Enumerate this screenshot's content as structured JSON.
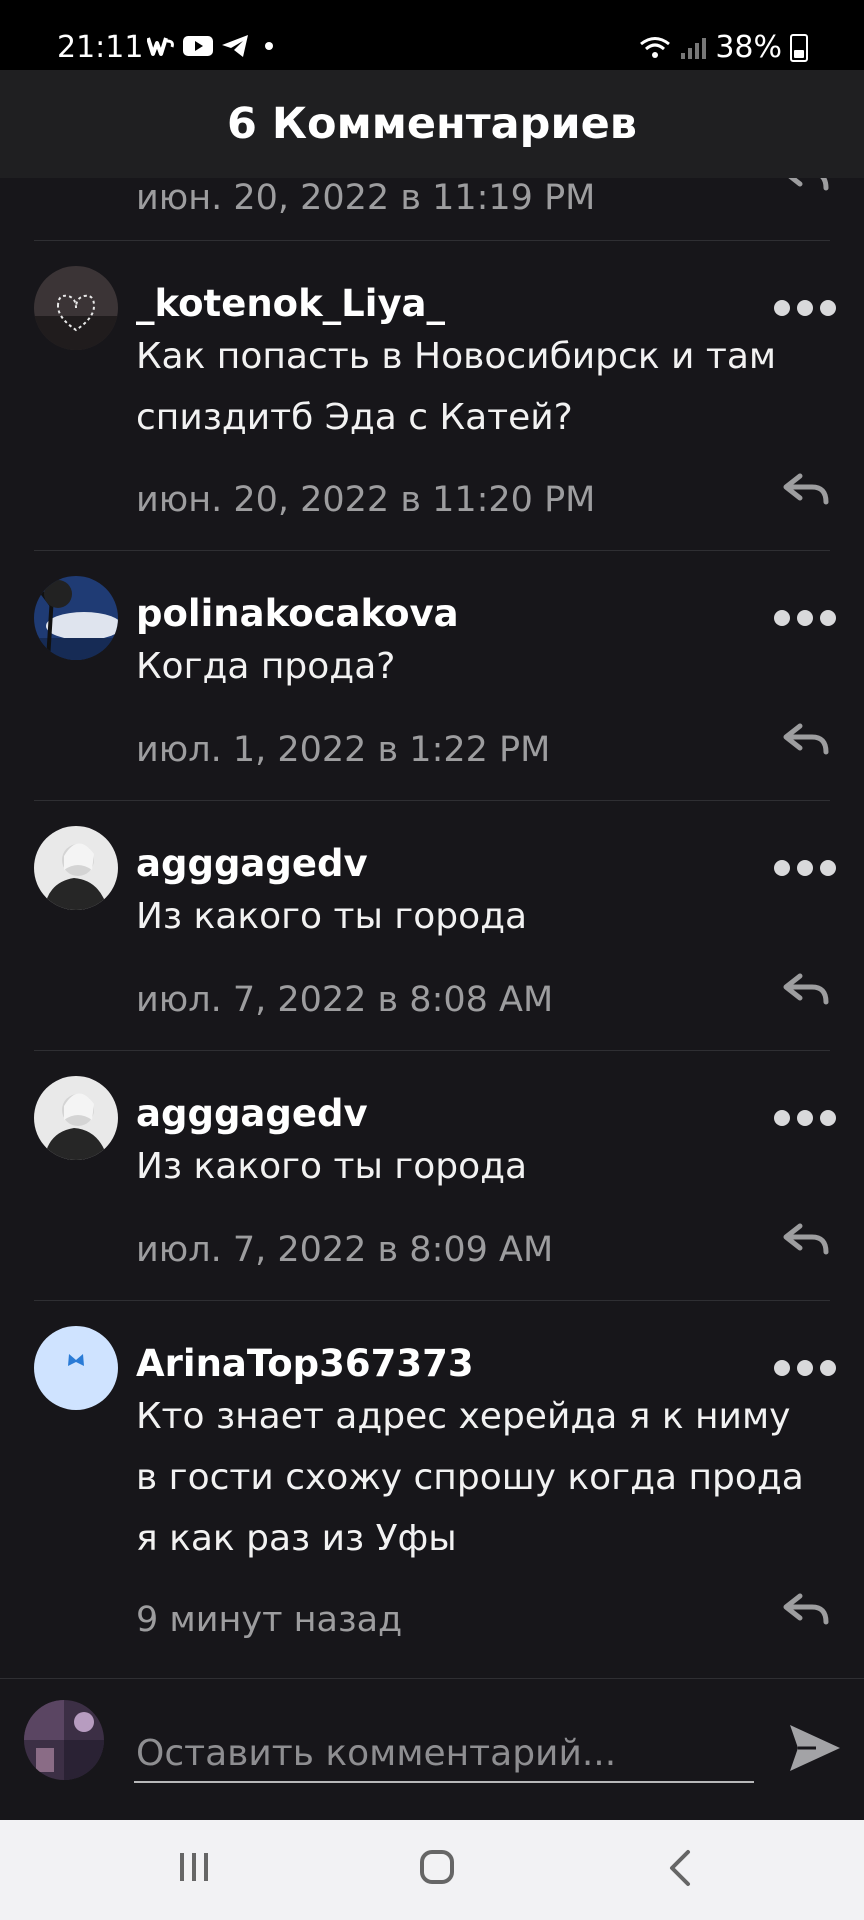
{
  "status": {
    "time": "21:11",
    "battery": "38%",
    "app_icons": [
      "w-app-icon",
      "youtube-icon",
      "telegram-icon"
    ]
  },
  "header": {
    "title": "6 Комментариев"
  },
  "comments": [
    {
      "username": "",
      "text": "",
      "date": "июн. 20, 2022 в 11:19 PM"
    },
    {
      "username": "_kotenok_Liya_",
      "text": "Как попасть в Новосибирск и там спиздитб Эда с Катей?",
      "date": "июн. 20, 2022 в 11:20 PM"
    },
    {
      "username": "polinakocakova",
      "text": "Когда прода?",
      "date": "июл. 1, 2022 в 1:22 PM"
    },
    {
      "username": "agggagedv",
      "text": "Из какого ты города",
      "date": "июл. 7, 2022 в 8:08 AM"
    },
    {
      "username": "agggagedv",
      "text": "Из какого ты города",
      "date": "июл. 7, 2022 в 8:09 AM"
    },
    {
      "username": "ArinaTop367373",
      "text": "Кто знает адрес херейда я к ниму в гости схожу спрошу когда прода я как раз из Уфы",
      "date": "9 минут назад"
    }
  ],
  "composer": {
    "placeholder": "Оставить комментарий..."
  },
  "colors": {
    "background": "#17161a",
    "header": "#1f1f21",
    "date": "#9d9d9f",
    "avatar_light": "#cfe3ff"
  }
}
